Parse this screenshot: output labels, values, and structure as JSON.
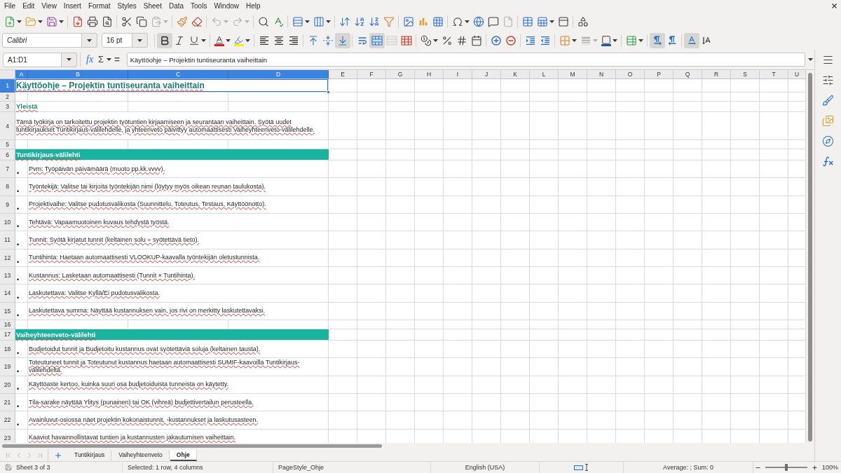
{
  "menu_bar": [
    "File",
    "Edit",
    "View",
    "Insert",
    "Format",
    "Styles",
    "Sheet",
    "Data",
    "Tools",
    "Window",
    "Help"
  ],
  "standard_toolbar": {
    "paste_disabled": true,
    "undo_disabled": true,
    "redo_disabled": true,
    "headers_footers_disabled": true
  },
  "formatting_toolbar": {
    "font_name": "Calibri",
    "font_size": "16 pt",
    "bold": true,
    "italic": false,
    "underline": false,
    "align_left": false,
    "align_center": false,
    "align_right": false,
    "align_top": false,
    "align_middle": false,
    "align_bottom": true,
    "wrap_text": false,
    "merge_and_center": true,
    "merge_cells_disabled": true,
    "border_style_disabled": true,
    "left_to_right": true,
    "right_to_left": false,
    "text_left_to_right": true,
    "text_top_to_bottom": false
  },
  "formula_bar": {
    "name_box": "A1:D1",
    "function_wizard": "fx",
    "sum": "Σ",
    "formula": "=",
    "content": "Käyttöohje – Projektin tuntiseuranta vaiheittain"
  },
  "sheet": {
    "spellcheck_marks": true,
    "columns": [
      {
        "label": "A",
        "selected": true
      },
      {
        "label": "B",
        "selected": true
      },
      {
        "label": "C",
        "selected": true
      },
      {
        "label": "D",
        "selected": true
      },
      {
        "label": "E",
        "selected": false
      },
      {
        "label": "F",
        "selected": false
      },
      {
        "label": "G",
        "selected": false
      },
      {
        "label": "H",
        "selected": false
      },
      {
        "label": "I",
        "selected": false
      },
      {
        "label": "J",
        "selected": false
      },
      {
        "label": "K",
        "selected": false
      },
      {
        "label": "L",
        "selected": false
      },
      {
        "label": "M",
        "selected": false
      },
      {
        "label": "N",
        "selected": false
      },
      {
        "label": "O",
        "selected": false
      },
      {
        "label": "P",
        "selected": false
      },
      {
        "label": "Q",
        "selected": false
      },
      {
        "label": "R",
        "selected": false
      },
      {
        "label": "S",
        "selected": false
      },
      {
        "label": "T",
        "selected": false
      },
      {
        "label": "U",
        "selected": false
      }
    ],
    "rows": [
      {
        "number": "1",
        "selected": true,
        "kind": "title",
        "text": "Käyttöohje – Projektin tuntiseuranta vaiheittain"
      },
      {
        "number": "2",
        "selected": false,
        "kind": "empty"
      },
      {
        "number": "3",
        "selected": false,
        "kind": "heading",
        "text": "Yleistä"
      },
      {
        "number": "4",
        "selected": false,
        "kind": "paragraph",
        "text": "Tämä työkirja on tarkoitettu projektin työtuntien kirjaamiseen ja seurantaan vaiheittain. Syötä uudet tuntikirjaukset Tuntikirjaus-välilehdelle, ja yhteenveto päivittyy automaattisesti Vaiheyhteenveto-välilehdelle."
      },
      {
        "number": "5",
        "selected": false,
        "kind": "empty"
      },
      {
        "number": "6",
        "selected": false,
        "kind": "section",
        "text": "Tuntikirjaus-välilehti"
      },
      {
        "number": "7",
        "selected": false,
        "kind": "bullet",
        "marker": "•",
        "text": "Pvm: Työpäivän päivämäärä (muoto pp.kk.vvvv)."
      },
      {
        "number": "8",
        "selected": false,
        "kind": "bullet",
        "marker": "•",
        "text": "Työntekijä: Valitse tai kirjoita työntekijän nimi (löytyy myös oikean reunan taulukosta)."
      },
      {
        "number": "9",
        "selected": false,
        "kind": "bullet",
        "marker": "•",
        "text": "Projektivaihe: Valitse pudotusvalikosta (Suunnittelu, Toteutus, Testaus, Käyttöönotto)."
      },
      {
        "number": "10",
        "selected": false,
        "kind": "bullet",
        "marker": "•",
        "text": "Tehtävä: Vapaamuotoinen kuvaus tehdystä työstä."
      },
      {
        "number": "11",
        "selected": false,
        "kind": "bullet",
        "marker": "•",
        "text": "Tunnit: Syötä kirjatut tunnit (keltainen solu = syötettävä tieto)."
      },
      {
        "number": "12",
        "selected": false,
        "kind": "bullet",
        "marker": "•",
        "text": "Tuntihinta: Haetaan automaattisesti VLOOKUP-kaavalla työntekijän oletustunnista."
      },
      {
        "number": "13",
        "selected": false,
        "kind": "bullet",
        "marker": "•",
        "text": "Kustannus: Lasketaan automaattisesti (Tunnit × Tuntihinta)."
      },
      {
        "number": "14",
        "selected": false,
        "kind": "bullet",
        "marker": "•",
        "text": "Laskutettava: Valitse Kyllä/Ei pudotusvalikosta."
      },
      {
        "number": "15",
        "selected": false,
        "kind": "bullet",
        "marker": "•",
        "text": "Laskutettava summa: Näyttää kustannuksen vain, jos rivi on merkitty laskutettavaksi."
      },
      {
        "number": "16",
        "selected": false,
        "kind": "empty"
      },
      {
        "number": "17",
        "selected": false,
        "kind": "section",
        "text": "Vaiheyhteenveto-välilehti"
      },
      {
        "number": "18",
        "selected": false,
        "kind": "bullet",
        "marker": "•",
        "text": "Budjetoidut tunnit ja Budjetoitu kustannus ovat syötettäviä soluja (keltainen tausta)."
      },
      {
        "number": "19",
        "selected": false,
        "kind": "bullet",
        "marker": "•",
        "text": "Toteutuneet tunnit ja Toteutunut kustannus haetaan automaattisesti SUMIF-kaavoilla Tuntikirjaus-välilehdeltä."
      },
      {
        "number": "20",
        "selected": false,
        "kind": "bullet",
        "marker": "•",
        "text": "Käyttöaste kertoo, kuinka suuri osa budjetoiduista tunneista on käytetty."
      },
      {
        "number": "21",
        "selected": false,
        "kind": "bullet",
        "marker": "•",
        "text": "Tila-sarake näyttää Ylitys (punainen) tai OK (vihreä) budjettivertailun perusteella."
      },
      {
        "number": "22",
        "selected": false,
        "kind": "bullet",
        "marker": "•",
        "text": "Avainluvut-osiossa näet projektin kokonaistunnit, -kustannukset ja laskutusasteen."
      },
      {
        "number": "23",
        "selected": false,
        "kind": "bullet",
        "text": "Kaaviot havainnollistavat tuntien ja kustannusten jakautumisen vaiheittain."
      }
    ]
  },
  "sheet_tabs": {
    "navigation_disabled": true,
    "tabs": [
      {
        "label": "Tuntikirjaus",
        "selected": false
      },
      {
        "label": "Vaiheyhteenveto",
        "selected": false
      },
      {
        "label": "Ohje",
        "selected": true
      }
    ]
  },
  "status_bar": {
    "sheet": "Sheet 3 of 3",
    "selection": "Selected: 1 row, 4 columns",
    "page_style": "PageStyle_Ohje",
    "language": "English (USA)",
    "summary": "Average: ; Sum: 0",
    "zoom": {
      "level": 0.5,
      "reading": "100%"
    }
  }
}
